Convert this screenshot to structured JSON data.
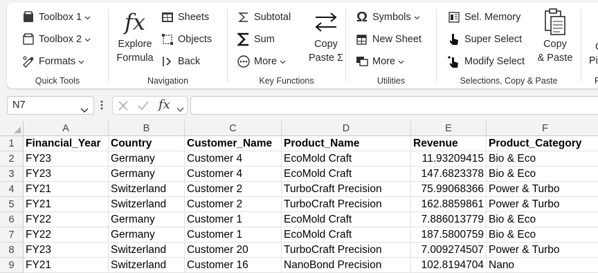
{
  "ribbon": {
    "quick_tools": {
      "label": "Quick Tools",
      "toolbox1": "Toolbox 1",
      "toolbox2": "Toolbox 2",
      "formats": "Formats"
    },
    "navigation": {
      "label": "Navigation",
      "explore_line1": "Explore",
      "explore_line2": "Formula",
      "sheets": "Sheets",
      "objects": "Objects",
      "back": "Back"
    },
    "key_functions": {
      "label": "Key Functions",
      "subtotal": "Subtotal",
      "sum": "Sum",
      "more": "More",
      "copy": "Copy",
      "paste_sigma": "Paste Σ"
    },
    "utilities": {
      "label": "Utilities",
      "symbols": "Symbols",
      "new_sheet": "New Sheet",
      "more": "More"
    },
    "selections": {
      "label": "Selections, Copy & Paste",
      "sel_memory": "Sel. Memory",
      "super_select": "Super Select",
      "modify_select": "Modify Select",
      "copy_line1": "Copy",
      "copy_line2": "& Paste"
    },
    "partial": {
      "line1": "C",
      "line2": "Pi",
      "line3": "P"
    }
  },
  "formula_bar": {
    "name_box": "N7",
    "fx": "fx",
    "formula": ""
  },
  "sheet": {
    "columns": [
      "A",
      "B",
      "C",
      "D",
      "E",
      "F"
    ],
    "row_numbers": [
      "1",
      "2",
      "3",
      "4",
      "5",
      "6",
      "7",
      "8",
      "9"
    ],
    "header": [
      "Financial_Year",
      "Country",
      "Customer_Name",
      "Product_Name",
      "Revenue",
      "Product_Category"
    ],
    "rows": [
      [
        "FY23",
        "Germany",
        "Customer 4",
        "EcoMold Craft",
        "11.93209415",
        "Bio & Eco"
      ],
      [
        "FY23",
        "Germany",
        "Customer 4",
        "EcoMold Craft",
        "147.6823378",
        "Bio & Eco"
      ],
      [
        "FY21",
        "Switzerland",
        "Customer 2",
        "TurboCraft Precision",
        "75.99068366",
        "Power & Turbo"
      ],
      [
        "FY21",
        "Switzerland",
        "Customer 2",
        "TurboCraft Precision",
        "162.8859861",
        "Power & Turbo"
      ],
      [
        "FY22",
        "Germany",
        "Customer 1",
        "EcoMold Craft",
        "7.886013779",
        "Bio & Eco"
      ],
      [
        "FY22",
        "Germany",
        "Customer 1",
        "EcoMold Craft",
        "187.5800759",
        "Bio & Eco"
      ],
      [
        "FY23",
        "Switzerland",
        "Customer 20",
        "TurboCraft Precision",
        "7.009274507",
        "Power & Turbo"
      ],
      [
        "FY21",
        "Switzerland",
        "Customer 16",
        "NanoBond Precision",
        "102.8194704",
        "Nano"
      ]
    ]
  },
  "icons": {
    "toolbox1": "toolbox-icon",
    "toolbox2": "toolbox-outline-icon",
    "formats": "brush-icon",
    "explore": "fx-icon",
    "sheets": "sheets-icon",
    "objects": "objects-icon",
    "back": "back-icon",
    "subtotal": "sigma-outline-icon",
    "sum": "sigma-icon",
    "more": "more-circle-icon",
    "copy_paste_sigma": "swap-arrows-icon",
    "symbols": "omega-icon",
    "new_sheet": "new-sheet-icon",
    "utilities_more": "monitor-icon",
    "sel_memory": "selection-memory-icon",
    "super_select": "cursor-icon",
    "modify_select": "cursor-plus-icon",
    "copy_paste": "clipboard-icon"
  }
}
